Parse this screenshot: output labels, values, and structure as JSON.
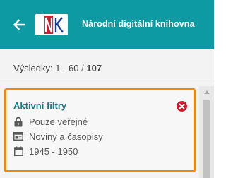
{
  "header": {
    "title": "Národní digitální knihovna",
    "logo_text": "NK",
    "back_icon": "arrow-left-icon",
    "background": "#0e9aa3"
  },
  "results": {
    "label": "Výsledky: 1 - 60",
    "separator": "/",
    "total": "107"
  },
  "active_filters": {
    "title": "Aktivní filtry",
    "clear_icon": "close-circle-icon",
    "border_color": "#f0860a",
    "items": [
      {
        "icon": "lock-icon",
        "label": "Pouze veřejné"
      },
      {
        "icon": "newspaper-icon",
        "label": "Noviny a časopisy"
      },
      {
        "icon": "calendar-icon",
        "label": "1945 - 1950"
      }
    ]
  }
}
